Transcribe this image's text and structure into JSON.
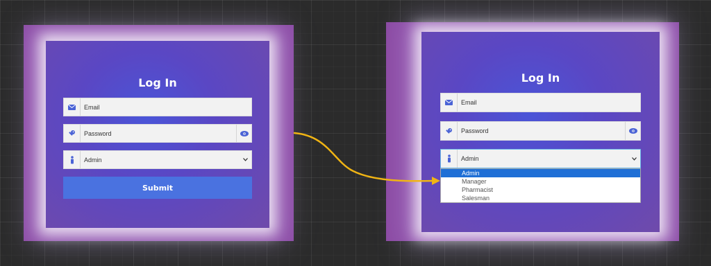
{
  "colors": {
    "frame": "#8b4aa3",
    "card_center": "#4a55d8",
    "submit": "#4a72e0",
    "icon": "#4a63d6",
    "arrow": "#f0b414",
    "option_selected": "#1f6fd6"
  },
  "left_form": {
    "title": "Log In",
    "email": {
      "placeholder": "Email",
      "icon": "envelope-icon"
    },
    "password": {
      "placeholder": "Password",
      "icon": "key-icon",
      "toggle_icon": "eye-icon"
    },
    "role": {
      "value": "Admin",
      "icon": "person-icon"
    },
    "submit_label": "Submit"
  },
  "right_form": {
    "title": "Log In",
    "email": {
      "placeholder": "Email",
      "icon": "envelope-icon"
    },
    "password": {
      "placeholder": "Password",
      "icon": "key-icon",
      "toggle_icon": "eye-icon"
    },
    "role": {
      "value": "Admin",
      "icon": "person-icon"
    },
    "options": [
      "Admin",
      "Manager",
      "Pharmacist",
      "Salesman"
    ],
    "selected_option": "Admin"
  }
}
